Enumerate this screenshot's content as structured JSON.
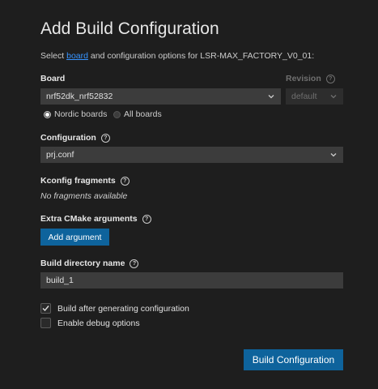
{
  "header": {
    "title": "Add Build Configuration",
    "subtitle_prefix": "Select ",
    "subtitle_link": "board",
    "subtitle_suffix": " and configuration options for LSR-MAX_FACTORY_V0_01:"
  },
  "board": {
    "label": "Board",
    "value": "nrf52dk_nrf52832",
    "filter_options": [
      {
        "label": "Nordic boards",
        "selected": true
      },
      {
        "label": "All boards",
        "selected": false
      }
    ]
  },
  "revision": {
    "label": "Revision",
    "value": "default",
    "disabled": true
  },
  "configuration": {
    "label": "Configuration",
    "value": "prj.conf"
  },
  "kconfig": {
    "label": "Kconfig fragments",
    "empty_text": "No fragments available"
  },
  "cmake": {
    "label": "Extra CMake arguments",
    "add_button": "Add argument"
  },
  "build_dir": {
    "label": "Build directory name",
    "value": "build_1"
  },
  "options": [
    {
      "label": "Build after generating configuration",
      "checked": true
    },
    {
      "label": "Enable debug options",
      "checked": false
    }
  ],
  "submit_button": "Build Configuration",
  "colors": {
    "background": "#1e1e1e",
    "accent": "#0e639c",
    "link": "#3794ff",
    "input": "#3c3c3c"
  }
}
